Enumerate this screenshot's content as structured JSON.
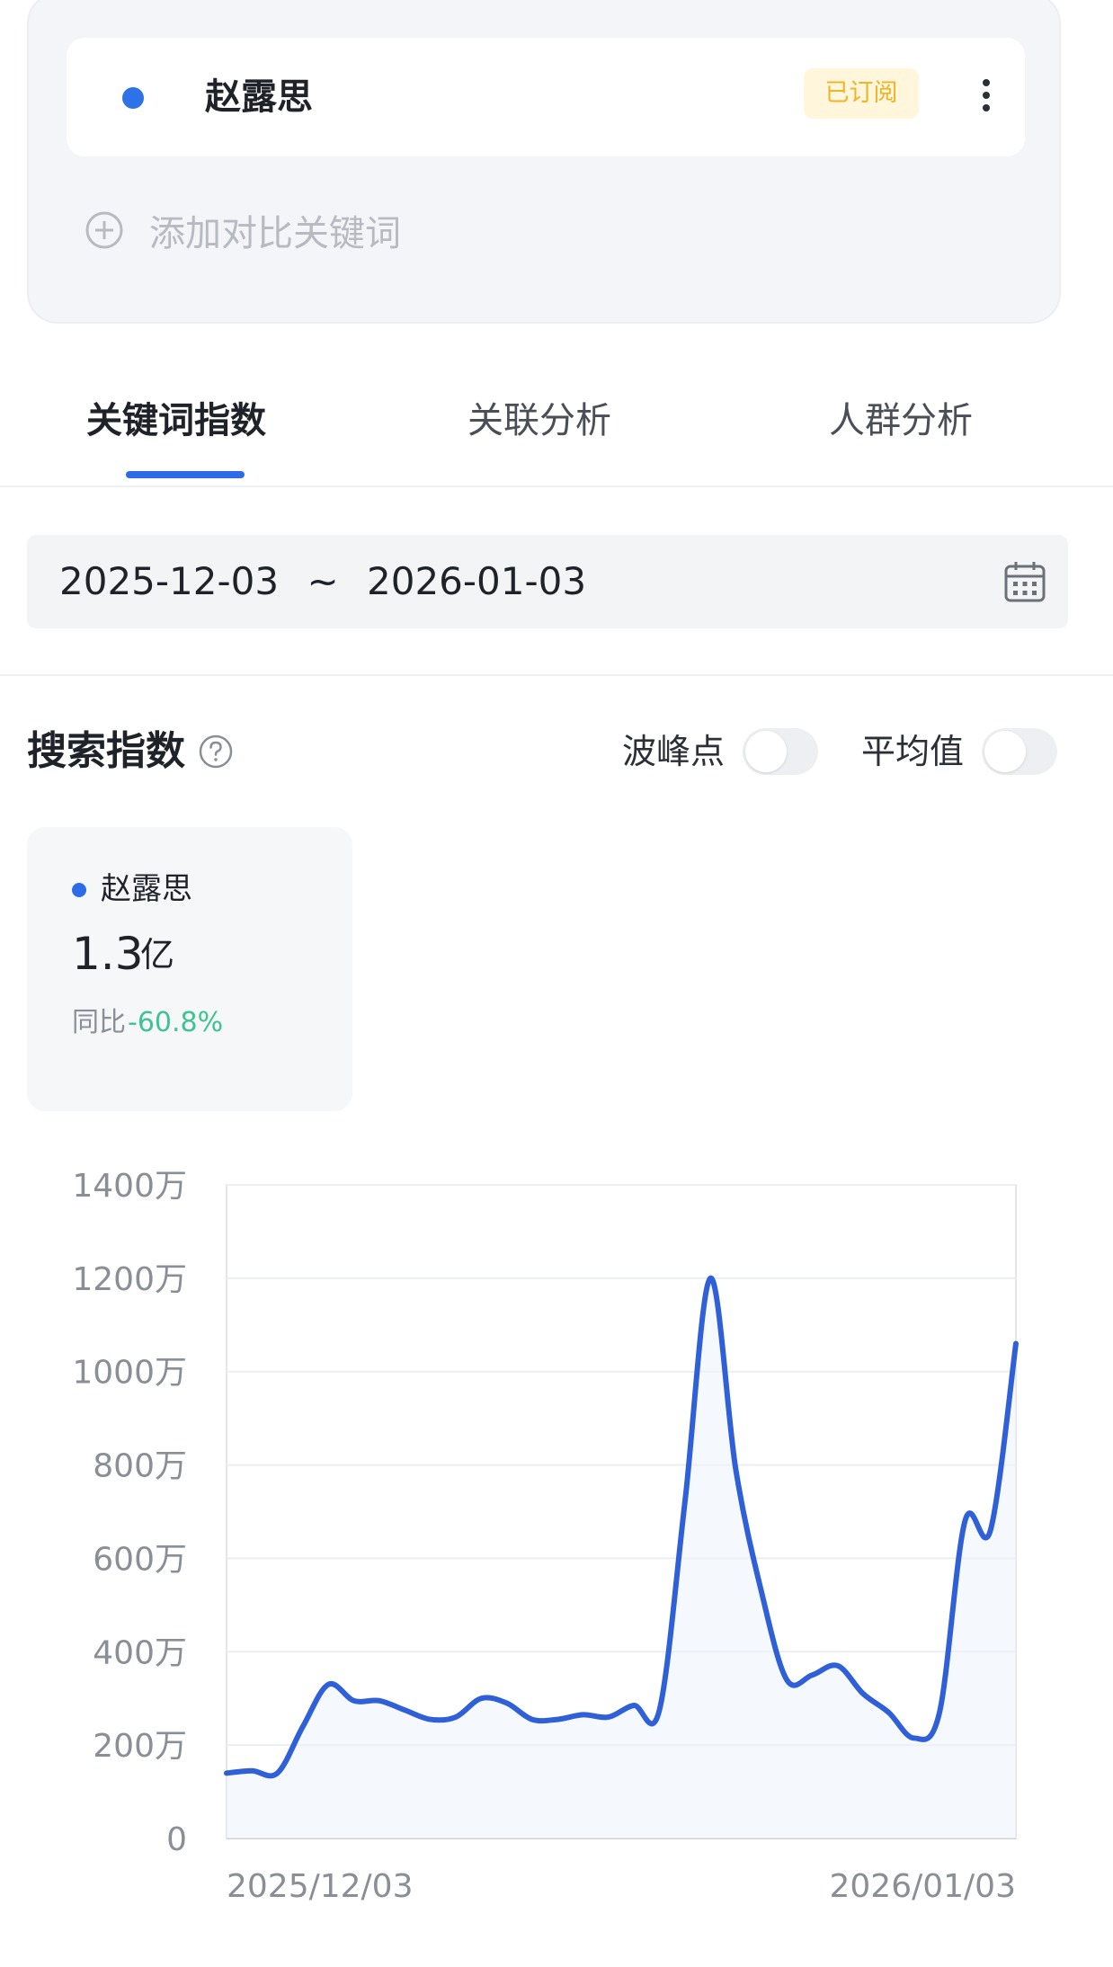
{
  "keyword_card": {
    "keyword": "赵露思",
    "keyword_color": "#2e72e8",
    "subscribed_badge": "已订阅",
    "more_icon": "more-vertical-icon",
    "add_label": "添加对比关键词",
    "add_icon": "plus-circle-icon"
  },
  "tabs": [
    {
      "label": "关键词指数",
      "active": true
    },
    {
      "label": "关联分析",
      "active": false
    },
    {
      "label": "人群分析",
      "active": false
    }
  ],
  "date_range": {
    "start": "2025-12-03",
    "separator": "~",
    "end": "2026-01-03",
    "icon": "calendar-icon"
  },
  "section": {
    "title": "搜索指数",
    "help_icon": "help-circle-icon",
    "toggles": [
      {
        "label": "波峰点",
        "on": false
      },
      {
        "label": "平均值",
        "on": false
      }
    ]
  },
  "summary": {
    "keyword": "赵露思",
    "value": "1.3",
    "unit": "亿",
    "yoy_label": "同比",
    "yoy_value": "-60.8%",
    "yoy_color": "#3fc38f"
  },
  "colors": {
    "accent": "#2e6be6",
    "line": "#3060d8"
  },
  "chart_data": {
    "type": "line",
    "xlabel": "",
    "ylabel": "",
    "x_tick_labels": [
      "2025/12/03",
      "2026/01/03"
    ],
    "y_ticks": [
      {
        "value": 0,
        "label": "0"
      },
      {
        "value": 200,
        "label": "200万"
      },
      {
        "value": 400,
        "label": "400万"
      },
      {
        "value": 600,
        "label": "600万"
      },
      {
        "value": 800,
        "label": "800万"
      },
      {
        "value": 1000,
        "label": "1000万"
      },
      {
        "value": 1200,
        "label": "1200万"
      },
      {
        "value": 1400,
        "label": "1400万"
      }
    ],
    "ylim": [
      0,
      1400
    ],
    "unit": "万",
    "grid": true,
    "series": [
      {
        "color": "#3060d8",
        "x": [
          "2025-12-03",
          "2025-12-04",
          "2025-12-05",
          "2025-12-06",
          "2025-12-07",
          "2025-12-08",
          "2025-12-09",
          "2025-12-10",
          "2025-12-11",
          "2025-12-12",
          "2025-12-13",
          "2025-12-14",
          "2025-12-15",
          "2025-12-16",
          "2025-12-17",
          "2025-12-18",
          "2025-12-19",
          "2025-12-20",
          "2025-12-21",
          "2025-12-22",
          "2025-12-23",
          "2025-12-24",
          "2025-12-25",
          "2025-12-26",
          "2025-12-27",
          "2025-12-28",
          "2025-12-29",
          "2025-12-30",
          "2025-12-31",
          "2026-01-01",
          "2026-01-02",
          "2026-01-03"
        ],
        "values": [
          140,
          145,
          140,
          240,
          330,
          295,
          295,
          275,
          255,
          260,
          300,
          290,
          255,
          255,
          265,
          260,
          285,
          275,
          720,
          1200,
          790,
          530,
          340,
          350,
          370,
          310,
          270,
          215,
          270,
          680,
          660,
          1060
        ]
      }
    ]
  }
}
